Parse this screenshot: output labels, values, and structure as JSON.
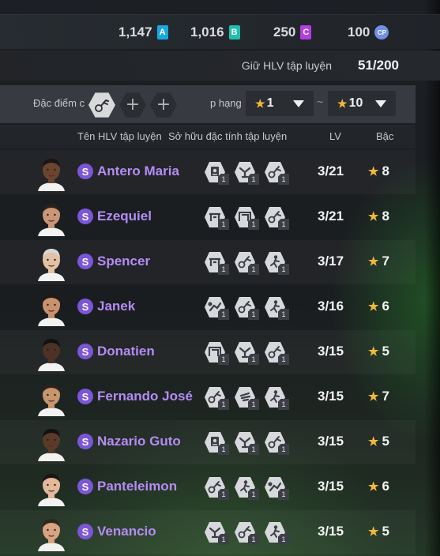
{
  "currencies": [
    {
      "value": "1,147",
      "badge": "A",
      "color": "#19a8e0"
    },
    {
      "value": "1,016",
      "badge": "B",
      "color": "#1fbfae"
    },
    {
      "value": "250",
      "badge": "C",
      "color": "#b43ee0"
    },
    {
      "value": "100",
      "badge": "CP",
      "color": "#6f8fe8"
    }
  ],
  "keep": {
    "label": "Giữ HLV tập luyện",
    "count": "51/200"
  },
  "filter": {
    "trait_label": "Đặc điểm c",
    "rank_label": "p hạng",
    "rank_from": "1",
    "rank_to": "10",
    "separator": "~"
  },
  "headers": {
    "name": "Tên HLV tập luyện",
    "traits": "Sở hữu đặc tính tập luyện",
    "lv": "LV",
    "grade": "Bậc"
  },
  "coaches": [
    {
      "tier": "S",
      "name": "Antero Maria",
      "lv": "3/21",
      "grade": "8",
      "trait_icons": [
        "shield-trait-icon",
        "tackle-trait-icon",
        "dribble-trait-icon"
      ],
      "trait_levels": [
        "1",
        "1",
        "1"
      ]
    },
    {
      "tier": "S",
      "name": "Ezequiel",
      "lv": "3/21",
      "grade": "8",
      "trait_icons": [
        "crossbar-trait-icon",
        "goal-trait-icon",
        "dribble-trait-icon"
      ],
      "trait_levels": [
        "1",
        "1",
        "1"
      ]
    },
    {
      "tier": "S",
      "name": "Spencer",
      "lv": "3/17",
      "grade": "7",
      "trait_icons": [
        "crossbar-trait-icon",
        "dribble-trait-icon",
        "player-trait-icon"
      ],
      "trait_levels": [
        "1",
        "1",
        "1"
      ]
    },
    {
      "tier": "S",
      "name": "Janek",
      "lv": "3/16",
      "grade": "6",
      "trait_icons": [
        "kick-trait-icon",
        "dribble-trait-icon",
        "player-trait-icon"
      ],
      "trait_levels": [
        "1",
        "1",
        "1"
      ]
    },
    {
      "tier": "S",
      "name": "Donatien",
      "lv": "3/15",
      "grade": "5",
      "trait_icons": [
        "goal-trait-icon",
        "tackle-trait-icon",
        "dribble-trait-icon"
      ],
      "trait_levels": [
        "1",
        "1",
        "1"
      ]
    },
    {
      "tier": "S",
      "name": "Fernando José",
      "lv": "3/15",
      "grade": "7",
      "trait_icons": [
        "dribble-trait-icon",
        "hand-trait-icon",
        "player-trait-icon"
      ],
      "trait_levels": [
        "1",
        "1",
        "1"
      ]
    },
    {
      "tier": "S",
      "name": "Nazario Guto",
      "lv": "3/15",
      "grade": "5",
      "trait_icons": [
        "shield-trait-icon",
        "tackle-trait-icon",
        "dribble-trait-icon"
      ],
      "trait_levels": [
        "1",
        "1",
        "1"
      ]
    },
    {
      "tier": "S",
      "name": "Panteleimon",
      "lv": "3/15",
      "grade": "6",
      "trait_icons": [
        "dribble-trait-icon",
        "player-trait-icon",
        "kick-trait-icon"
      ],
      "trait_levels": [
        "1",
        "1",
        "1"
      ]
    },
    {
      "tier": "S",
      "name": "Venancio",
      "lv": "3/15",
      "grade": "5",
      "trait_icons": [
        "tackle-trait-icon",
        "dribble-trait-icon",
        "player-trait-icon"
      ],
      "trait_levels": [
        "1",
        "1",
        "1"
      ]
    }
  ]
}
